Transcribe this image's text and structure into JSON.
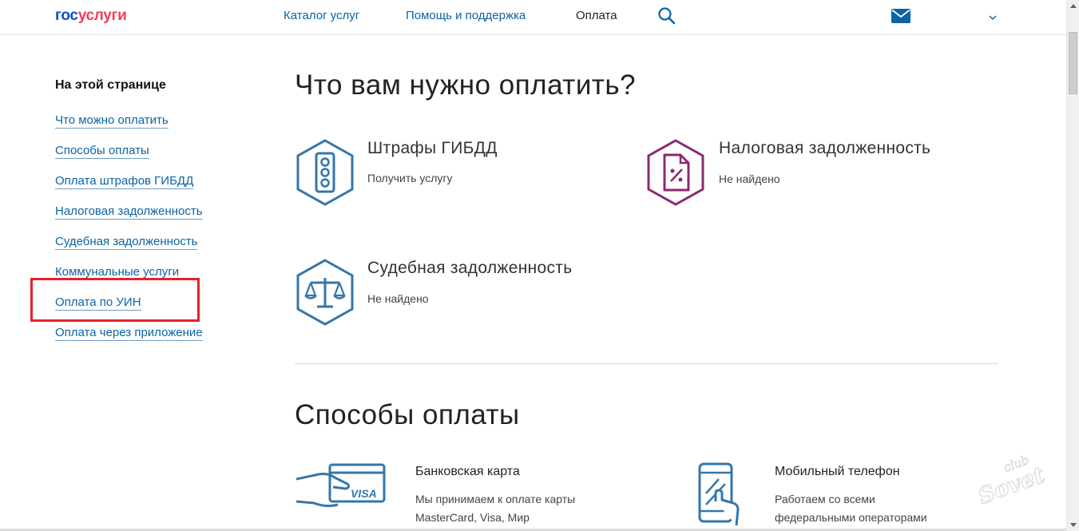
{
  "header": {
    "logo_part1": "гос",
    "logo_part2": "услуги",
    "nav": [
      "Каталог услуг",
      "Помощь и поддержка",
      "Оплата"
    ]
  },
  "sidebar": {
    "title": "На этой странице",
    "links": [
      "Что можно оплатить",
      "Способы оплаты",
      "Оплата штрафов ГИБДД",
      "Налоговая задолженность",
      "Судебная задолженность",
      "Коммунальные услуги",
      "Оплата по УИН",
      "Оплата через приложение"
    ]
  },
  "main": {
    "heading": "Что вам нужно оплатить?",
    "services": [
      {
        "title": "Штрафы ГИБДД",
        "subtitle": "Получить услугу",
        "icon": "traffic-light-icon",
        "color": "#3576a8"
      },
      {
        "title": "Налоговая задолженность",
        "subtitle": "Не найдено",
        "icon": "tax-document-icon",
        "color": "#8b2a72"
      },
      {
        "title": "Судебная задолженность",
        "subtitle": "Не найдено",
        "icon": "scales-icon",
        "color": "#3576a8"
      }
    ],
    "payment_heading": "Способы оплаты",
    "payment_methods": [
      {
        "title": "Банковская карта",
        "desc_line1": "Мы принимаем к оплате карты",
        "desc_line2": "MasterCard, Visa, Мир",
        "icon": "bank-card-icon",
        "card_label": "VISA"
      },
      {
        "title": "Мобильный телефон",
        "desc_line1": "Работаем со всеми",
        "desc_line2": "федеральными операторами",
        "icon": "mobile-phone-icon"
      }
    ]
  },
  "watermark": {
    "text1": "club",
    "text2": "Sovet"
  },
  "colors": {
    "link": "#0b64a3",
    "highlight": "#e8212a",
    "icon_blue": "#3576a8",
    "icon_purple": "#8b2a72"
  }
}
